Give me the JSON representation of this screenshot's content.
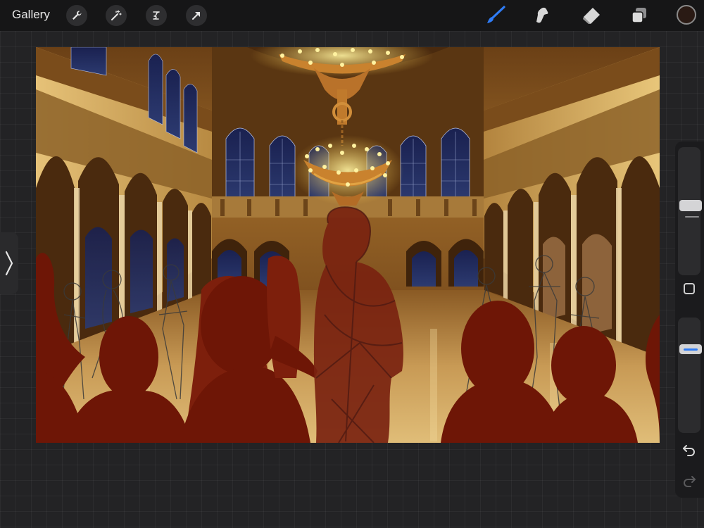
{
  "topbar": {
    "gallery_label": "Gallery",
    "left_tools": [
      "wrench-icon",
      "magic-wand-icon",
      "selection-icon",
      "transform-arrow-icon"
    ],
    "right_tools": [
      "brush-icon",
      "smudge-icon",
      "eraser-icon",
      "layers-icon"
    ],
    "active_tool": "brush-icon",
    "active_color": "#2a1a14"
  },
  "sidebar": {
    "brush_size_fraction": 0.55,
    "brush_opacity_fraction": 0.75,
    "icons": [
      "modify-square-icon",
      "undo-icon",
      "redo-icon"
    ]
  },
  "colors": {
    "accent_blue": "#2f7cf6",
    "canvas_gold": "#d9b56a",
    "silhouette_red": "#6e1606",
    "window_navy": "#1c2450"
  }
}
